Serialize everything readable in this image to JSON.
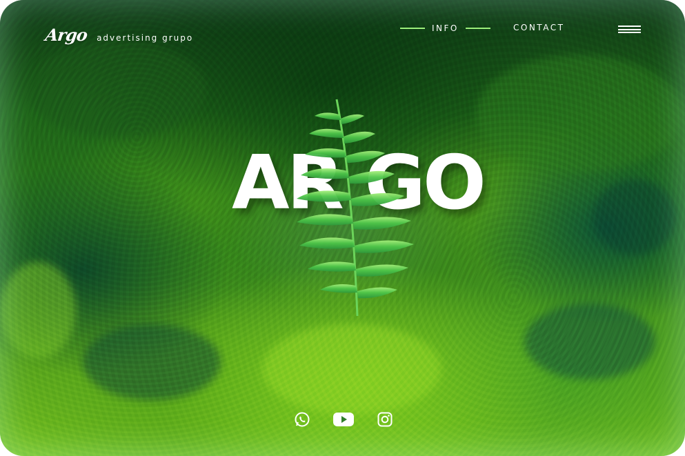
{
  "header": {
    "logo_text": "Argo",
    "tagline": "advertising grupo",
    "nav": {
      "info_label": "INFO",
      "contact_label": "CONTACT"
    },
    "menu_icon": "hamburger-menu-icon"
  },
  "hero": {
    "title": "AR GO",
    "image": "fern-over-moss"
  },
  "social": {
    "icons": [
      "whatsapp-icon",
      "youtube-icon",
      "instagram-icon"
    ]
  },
  "colors": {
    "accent": "#9cf07a",
    "text": "#ffffff",
    "background_dark": "#0f3a16",
    "background_light": "#78c221"
  }
}
